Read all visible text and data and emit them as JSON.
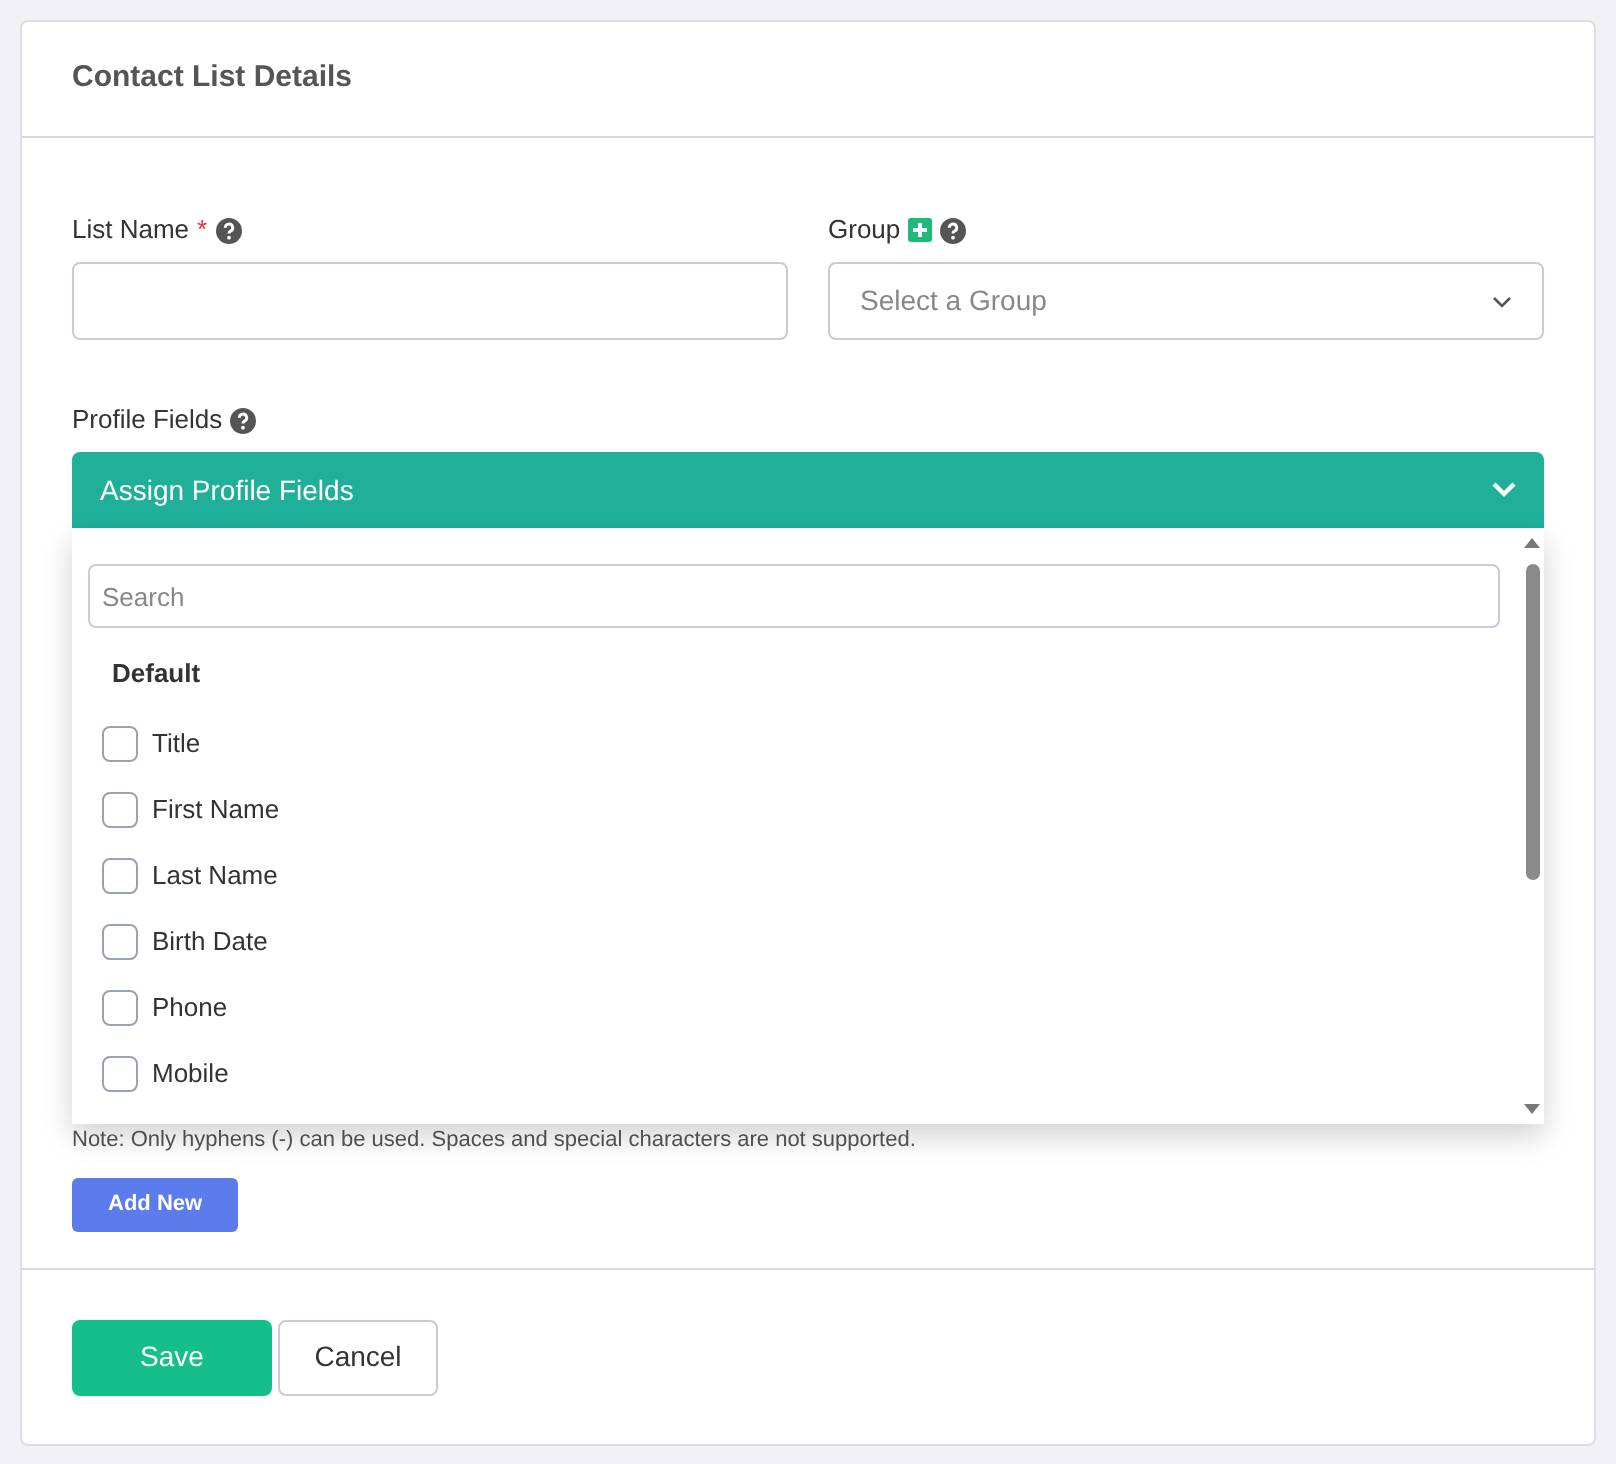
{
  "card": {
    "title": "Contact List Details"
  },
  "list_name": {
    "label": "List Name",
    "required_mark": "*"
  },
  "group": {
    "label": "Group",
    "placeholder": "Select a Group"
  },
  "profile_fields": {
    "label": "Profile Fields",
    "button": "Assign Profile Fields",
    "expanded": true,
    "search_placeholder": "Search",
    "section": "Default",
    "options": [
      {
        "label": "Title",
        "checked": false
      },
      {
        "label": "First Name",
        "checked": false
      },
      {
        "label": "Last Name",
        "checked": false
      },
      {
        "label": "Birth Date",
        "checked": false
      },
      {
        "label": "Phone",
        "checked": false
      },
      {
        "label": "Mobile",
        "checked": false
      }
    ]
  },
  "note": "Note: Only hyphens (-) can be used. Spaces and special characters are not supported.",
  "add_new": "Add New",
  "buttons": {
    "save": "Save",
    "cancel": "Cancel"
  }
}
